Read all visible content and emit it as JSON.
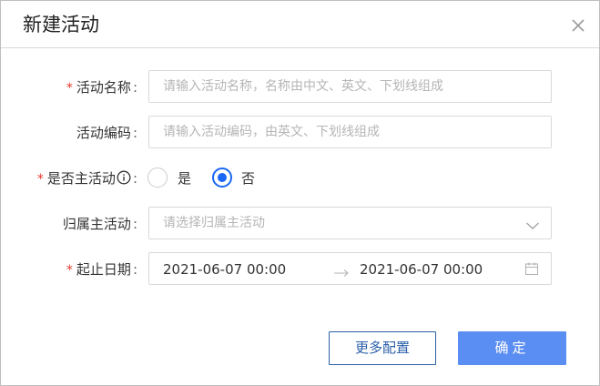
{
  "dialog": {
    "title": "新建活动",
    "close_icon": "close-icon"
  },
  "form": {
    "name": {
      "required_mark": "*",
      "label": "活动名称",
      "colon": ":",
      "value": "",
      "placeholder": "请输入活动名称，名称由中文、英文、下划线组成"
    },
    "code": {
      "label": "活动编码",
      "colon": ":",
      "value": "",
      "placeholder": "请输入活动编码，由英文、下划线组成"
    },
    "is_main": {
      "required_mark": "*",
      "label": "是否主活动",
      "info_icon": "info-circle-icon",
      "colon": ":",
      "options": [
        {
          "label": "是",
          "checked": false
        },
        {
          "label": "否",
          "checked": true
        }
      ]
    },
    "parent": {
      "label": "归属主活动",
      "colon": ":",
      "placeholder": "请选择归属主活动",
      "chevron_icon": "chevron-down-icon"
    },
    "date_range": {
      "required_mark": "*",
      "label": "起止日期",
      "colon": ":",
      "start": "2021-06-07 00:00",
      "end": "2021-06-07 00:00",
      "arrow_icon": "arrow-right-icon",
      "calendar_icon": "calendar-icon"
    }
  },
  "footer": {
    "more_config_label": "更多配置",
    "confirm_label": "确定"
  },
  "colors": {
    "required": "#e8362a",
    "primary": "#5b8ef2",
    "radio_active": "#1a66f5",
    "outline_button": "#2b5fa8"
  }
}
